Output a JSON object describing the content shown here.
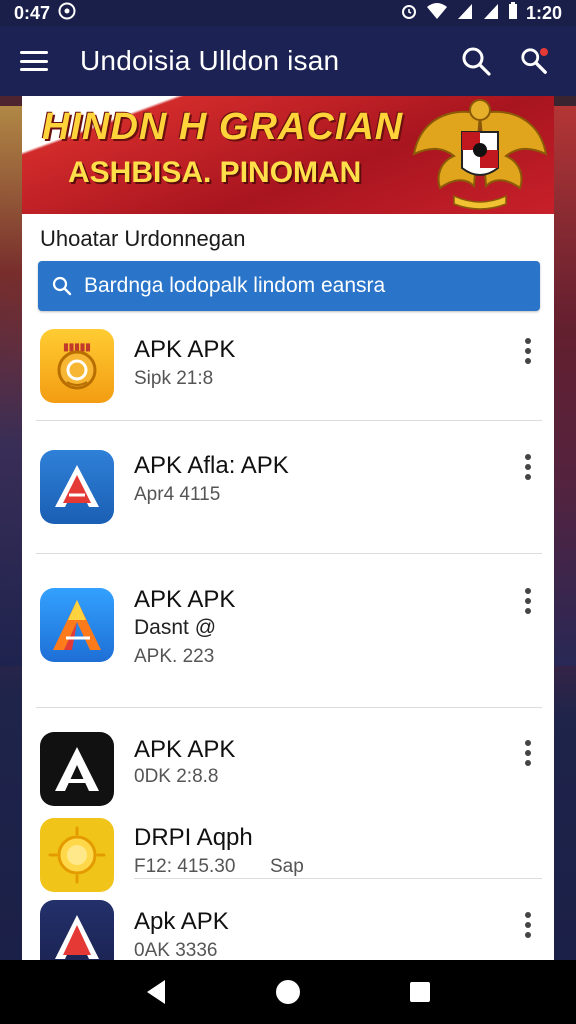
{
  "status_bar": {
    "time": "0:47",
    "clock_right": "1:20",
    "icons": [
      "settings-circle-icon",
      "alarm-icon",
      "wifi-icon",
      "signal-icon",
      "signal-icon",
      "battery-icon"
    ]
  },
  "app_bar": {
    "title": "Undoisia Ulldon isan",
    "menu_icon": "menu-icon",
    "search_icon": "search-icon",
    "search_alert_icon": "search-alert-icon"
  },
  "banner": {
    "line1": "HINDN H GRACIAN",
    "line2": "ASHBISA. PINOMAN",
    "emblem": "garuda-emblem"
  },
  "section": {
    "title": "Uhoatar Urdonnegan"
  },
  "search": {
    "icon": "search-icon",
    "text": "Bardnga lodopalk lindom eansra"
  },
  "apps": [
    {
      "name": "APK APK",
      "sub1": "Sipk 21:8",
      "sub2": "",
      "sub3": "",
      "icon": "gold-badge-icon"
    },
    {
      "name": "APK Afla: APK",
      "sub1": "Apr4 4115",
      "sub2": "",
      "sub3": "",
      "icon": "red-a-icon"
    },
    {
      "name": "APK APK",
      "sub1": "Dasnt @",
      "sub2": "APK. 223",
      "sub3": "",
      "icon": "colorful-a-icon"
    },
    {
      "name": "APK APK",
      "sub1": "0DK 2:8.8",
      "sub2": "",
      "sub3": "",
      "icon": "black-a-icon"
    },
    {
      "name": "DRPI Aqph",
      "sub1": "F12: 415.30",
      "sub2": "",
      "sub3": "Sap",
      "icon": "sun-icon"
    },
    {
      "name": "Apk APK",
      "sub1": "0AK 3336",
      "sub2": "",
      "sub3": "",
      "icon": "navy-a-icon"
    }
  ],
  "nav": {
    "back": "back-icon",
    "home": "home-icon",
    "recents": "recents-icon"
  },
  "colors": {
    "app_bar": "#1c2354",
    "search_bar": "#2a75c9",
    "banner_red": "#c8202a",
    "banner_text": "#ffd43a"
  }
}
